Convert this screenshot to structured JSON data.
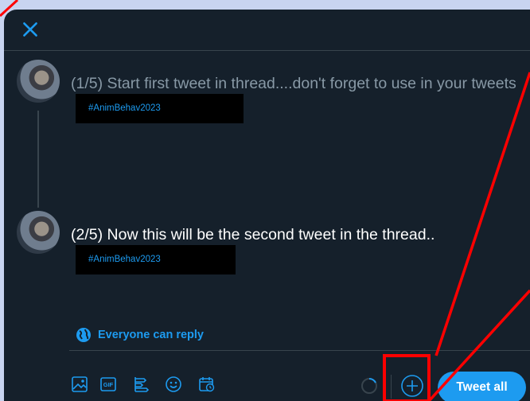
{
  "header": {
    "close_icon": "close-icon"
  },
  "tweets": [
    {
      "text": "(1/5) Start first tweet in thread....don't forget to use in your tweets",
      "hashtag": "#AnimBehav2023"
    },
    {
      "text": "(2/5) Now this will be the second tweet in the thread..",
      "hashtag": "#AnimBehav2023"
    }
  ],
  "reply_setting": {
    "label": "Everyone can reply",
    "icon": "globe-icon"
  },
  "toolbar": {
    "icons": [
      "image-icon",
      "gif-icon",
      "poll-icon",
      "emoji-icon",
      "schedule-icon"
    ],
    "gif_label": "GIF",
    "add_icon": "add-tweet-icon",
    "submit_label": "Tweet all"
  },
  "colors": {
    "background": "#15202b",
    "accent": "#1d9bf0",
    "annotation": "#ff0000",
    "page_bg": "#c8d4f0"
  }
}
